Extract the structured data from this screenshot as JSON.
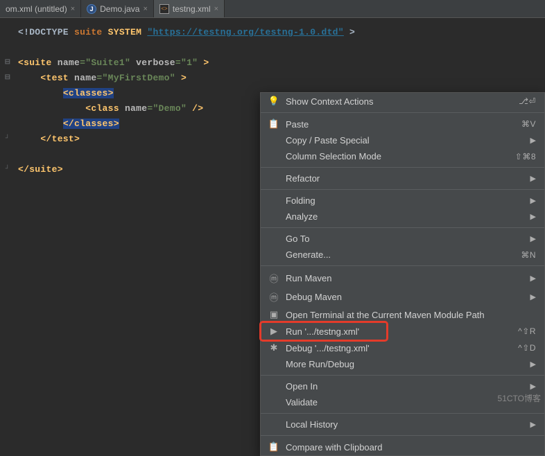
{
  "tabs": [
    {
      "label": "om.xml (untitled)",
      "icon": ""
    },
    {
      "label": "Demo.java",
      "icon": "J"
    },
    {
      "label": "testng.xml",
      "icon": "<>",
      "active": true
    }
  ],
  "code": {
    "doctype_open": "<!DOCTYPE ",
    "doctype_suite": "suite ",
    "doctype_system": "SYSTEM ",
    "dtd_url": "\"https://testng.org/testng-1.0.dtd\"",
    "gt": " >",
    "suite_open1": "<suite ",
    "suite_attr1": "name",
    "suite_eq": "=",
    "suite_val1": "\"Suite1\"",
    "suite_sp": " ",
    "suite_attr2": "verbose",
    "suite_val2": "\"1\"",
    "test_open": "<test ",
    "test_attr": "name",
    "test_val": "\"MyFirstDemo\"",
    "classes_open": "<classes>",
    "class_open": "<class ",
    "class_attr": "name",
    "class_val": "\"Demo\"",
    "class_close": " />",
    "classes_close": "</classes>",
    "test_close": "</test>",
    "suite_close": "</suite>"
  },
  "menu": {
    "context_actions": "Show Context Actions",
    "context_sc": "⎇⏎",
    "paste": "Paste",
    "paste_sc": "⌘V",
    "copy_special": "Copy / Paste Special",
    "col_sel": "Column Selection Mode",
    "col_sel_sc": "⇧⌘8",
    "refactor": "Refactor",
    "folding": "Folding",
    "analyze": "Analyze",
    "goto": "Go To",
    "generate": "Generate...",
    "generate_sc": "⌘N",
    "run_maven": "Run Maven",
    "debug_maven": "Debug Maven",
    "open_term": "Open Terminal at the Current Maven Module Path",
    "run_xml": "Run '.../testng.xml'",
    "run_xml_sc": "^⇧R",
    "debug_xml": "Debug '.../testng.xml'",
    "debug_xml_sc": "^⇧D",
    "more_run": "More Run/Debug",
    "open_in": "Open In",
    "validate": "Validate",
    "local_history": "Local History",
    "compare_clip": "Compare with Clipboard"
  },
  "watermark": "51CTO博客"
}
